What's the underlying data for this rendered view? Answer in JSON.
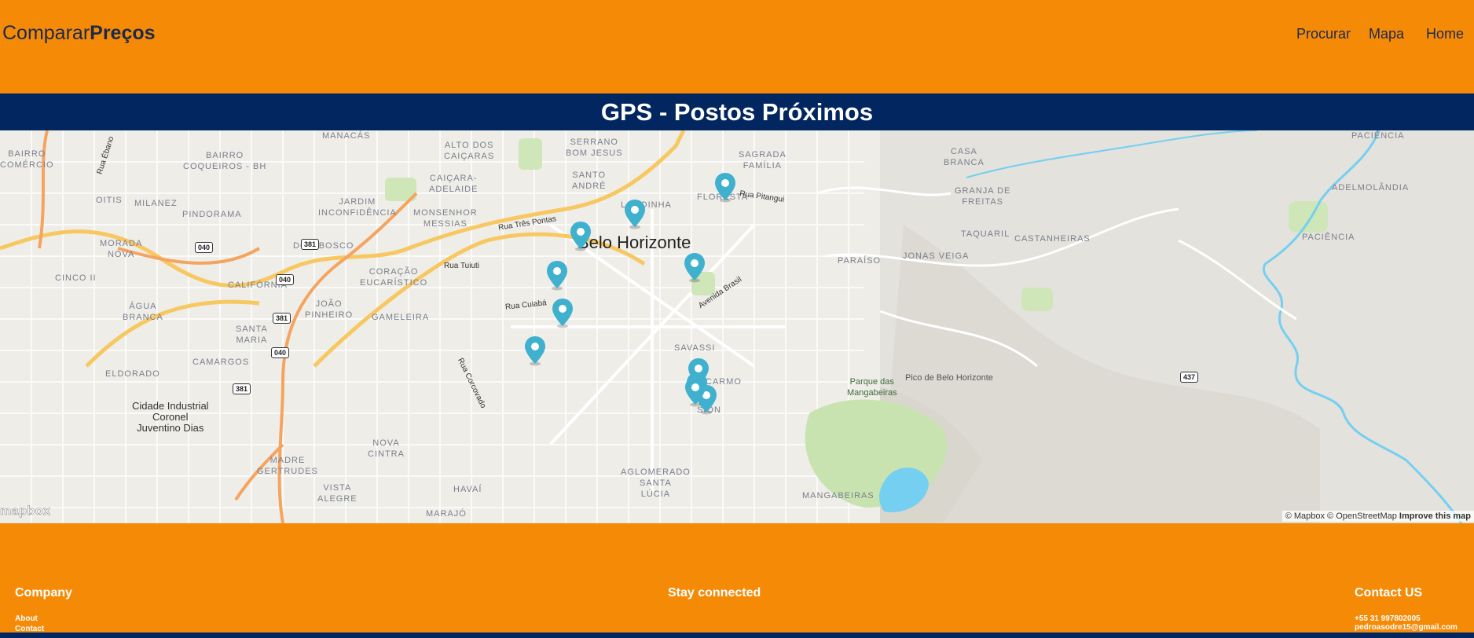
{
  "brand": {
    "light": "Comparar",
    "bold": "Preços"
  },
  "nav": {
    "procurar": "Procurar",
    "mapa": "Mapa",
    "home": "Home"
  },
  "page_title": "GPS - Postos Próximos",
  "map": {
    "city_label": "Belo Horizonte",
    "neighborhoods": {
      "bairro_comercio": "BAIRRO\nCOMÉRCIO",
      "bairro_coqueiros": "BAIRRO\nCOQUEIROS - BH",
      "oitis": "OITIS",
      "milanez": "MILANEZ",
      "pindorama": "PINDORAMA",
      "jardim_inconfidencia": "JARDIM\nINCONFIDÊNCIA",
      "monsenhor_messias": "MONSENHOR\nMESSIAS",
      "alto_dos_caicaras": "ALTO DOS\nCAIÇARAS",
      "caicara_adelaide": "CAIÇARA-\nADELAIDE",
      "santo_andre": "SANTO\nANDRÉ",
      "serrano_bom_jesus": "SERRANO\nBOM JESUS",
      "lagoinha": "LAGOINHA",
      "sagrada_familia": "SAGRADA\nFAMÍLIA",
      "floresta": "FLORESTA",
      "casa_branca": "CASA\nBRANCA",
      "granja_de_freitas": "GRANJA DE\nFREITAS",
      "taquaril": "TAQUARIL",
      "castanheiras": "CASTANHEIRAS",
      "jonas_veiga": "JONAS VEIGA",
      "paraiso": "PARAÍSO",
      "pacienca_top": "PACIÊNCIA",
      "adelmolandia": "ADELMOLÂNDIA",
      "paciencia": "PACIÊNCIA",
      "morada_nova": "MORADA\nNOVA",
      "dom_bosco": "DOM BOSCO",
      "cinco_ii": "CINCO II",
      "california": "CALIFÓRNIA",
      "coracao_eucaristico": "CORAÇÃO\nEUCARÍSTICO",
      "joao_pinheiro": "JOÃO\nPINHEIRO",
      "agua_branca": "ÁGUA\nBRANCA",
      "gameleira": "GAMELEIRA",
      "santa_maria": "SANTA\nMARIA",
      "camargos": "CAMARGOS",
      "eldorado": "ELDORADO",
      "savassi": "SAVASSI",
      "carmo": "CARMO",
      "sion": "SION",
      "nova_cintra": "NOVA\nCINTRA",
      "madre_gertrudes": "MADRE\nGERTRUDES",
      "vista_alegre": "VISTA\nALEGRE",
      "havai": "HAVAÍ",
      "marajo": "MARAJÓ",
      "aglomerado_santa_lucia": "AGLOMERADO\nSANTA\nLÚCIA",
      "mangabeiras": "MANGABEIRAS",
      "manacas": "MANACÁS"
    },
    "roads": {
      "rua_tres_pontas": "Rua Três Pontas",
      "rua_tuiuti": "Rua Tuiuti",
      "rua_pitangui": "Rua Pitangui",
      "rua_cuiaba": "Rua Cuiabá",
      "avenida_brasil": "Avenida Brasil",
      "rua_corcovado": "Rua Corcovado",
      "rua_ebano": "Rua Ébano"
    },
    "shields": {
      "s040a": "040",
      "s381a": "381",
      "s040b": "040",
      "s381b": "381",
      "s040c": "040",
      "s381c": "381",
      "s437": "437"
    },
    "places": {
      "cidade_industrial": "Cidade Industrial\nCoronel\nJuventino Dias",
      "parque_mangabeiras": "Parque das\nMangabeiras",
      "pico_bh": "Pico de Belo Horizonte"
    },
    "marker_count": 11,
    "attribution": {
      "text": "© Mapbox © OpenStreetMap",
      "improve": "Improve this map"
    },
    "logo": "mapbox",
    "colors": {
      "marker": "#3fb1ce",
      "water": "#75cff0",
      "park": "#c8e3b0",
      "highway": "#f7c862"
    }
  },
  "footer": {
    "company": {
      "heading": "Company",
      "about": "About",
      "contact": "Contact"
    },
    "stay_connected": "Stay connected",
    "contact_us": {
      "heading": "Contact US",
      "phone": "+55 31 997802005",
      "email": "pedroasodre15@gmail.com"
    }
  }
}
